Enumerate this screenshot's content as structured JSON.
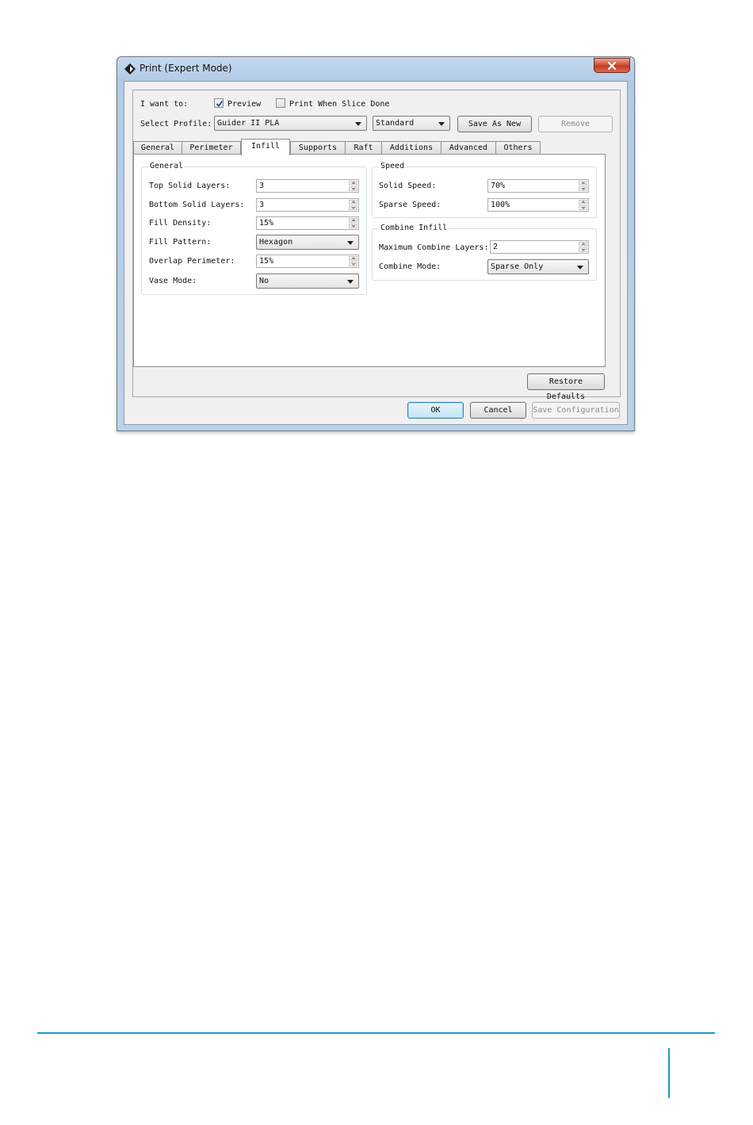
{
  "window": {
    "title": "Print (Expert Mode)"
  },
  "top": {
    "i_want_to_label": "I want to:",
    "preview_label": "Preview",
    "preview_checked": true,
    "print_when_done_label": "Print When Slice Done",
    "print_when_done_checked": false,
    "select_profile_label": "Select Profile:",
    "profile_value": "Guider II PLA",
    "quality_value": "Standard",
    "save_as_new_label": "Save As New",
    "remove_label": "Remove"
  },
  "tabs": [
    {
      "label": "General"
    },
    {
      "label": "Perimeter"
    },
    {
      "label": "Infill"
    },
    {
      "label": "Supports"
    },
    {
      "label": "Raft"
    },
    {
      "label": "Additions"
    },
    {
      "label": "Advanced"
    },
    {
      "label": "Others"
    }
  ],
  "active_tab": "Infill",
  "general_group": {
    "title": "General",
    "top_solid_layers_label": "Top Solid Layers:",
    "top_solid_layers_value": "3",
    "bottom_solid_layers_label": "Bottom Solid Layers:",
    "bottom_solid_layers_value": "3",
    "fill_density_label": "Fill Density:",
    "fill_density_value": "15%",
    "fill_pattern_label": "Fill Pattern:",
    "fill_pattern_value": "Hexagon",
    "overlap_perimeter_label": "Overlap Perimeter:",
    "overlap_perimeter_value": "15%",
    "vase_mode_label": "Vase Mode:",
    "vase_mode_value": "No"
  },
  "speed_group": {
    "title": "Speed",
    "solid_speed_label": "Solid Speed:",
    "solid_speed_value": "70%",
    "sparse_speed_label": "Sparse Speed:",
    "sparse_speed_value": "100%"
  },
  "combine_group": {
    "title": "Combine Infill",
    "max_combine_layers_label": "Maximum Combine Layers:",
    "max_combine_layers_value": "2",
    "combine_mode_label": "Combine Mode:",
    "combine_mode_value": "Sparse Only"
  },
  "buttons": {
    "restore_defaults": "Restore Defaults",
    "ok": "OK",
    "cancel": "Cancel",
    "save_configuration": "Save Configuration"
  },
  "colors": {
    "accent_line": "#1e97c9",
    "close_button": "#c9432b"
  }
}
